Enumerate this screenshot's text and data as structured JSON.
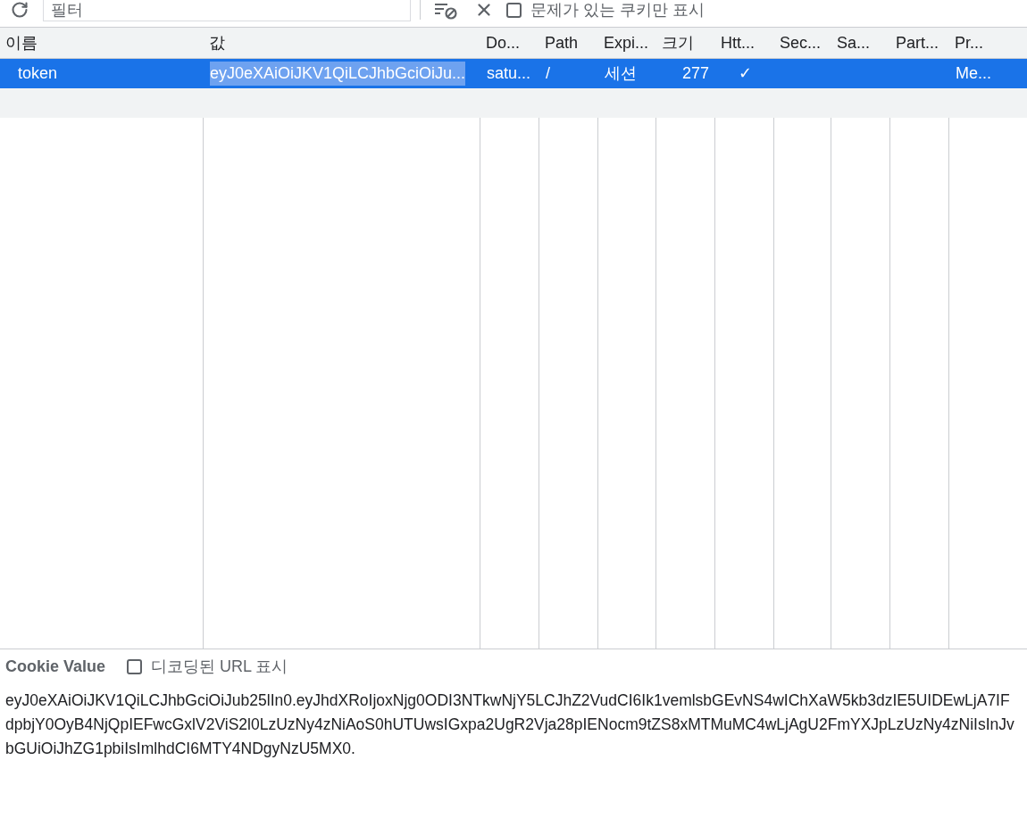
{
  "toolbar": {
    "filter_placeholder": "필터",
    "issues_only": {
      "label": "문제가 있는 쿠키만 표시",
      "checked": false
    }
  },
  "table": {
    "columns": [
      "이름",
      "값",
      "Do...",
      "Path",
      "Expi...",
      "크기",
      "Htt...",
      "Sec...",
      "Sa...",
      "Part...",
      "Pr..."
    ],
    "rows": [
      {
        "selected": true,
        "cells": [
          "token",
          "eyJ0eXAiOiJKV1QiLCJhbGciOiJu...",
          "satu...",
          "/",
          "세션",
          "277",
          "✓",
          "",
          "",
          "",
          "Me..."
        ]
      }
    ]
  },
  "details": {
    "title": "Cookie Value",
    "decoded": {
      "label": "디코딩된 URL 표시",
      "checked": false
    },
    "value": "eyJ0eXAiOiJKV1QiLCJhbGciOiJub25lIn0.eyJhdXRoIjoxNjg0ODI3NTkwNjY5LCJhZ2VudCI6Ik1vemlsbGEvNS4wIChXaW5kb3dzIE5UIDEwLjA7IFdpbjY0OyB4NjQpIEFwcGxlV2ViS2l0LzUzNy4zNiAoS0hUTUwsIGxpa2UgR2Vja28pIENocm9tZS8xMTMuMC4wLjAgU2FmYXJpLzUzNy4zNiIsInJvbGUiOiJhZG1pbiIsImlhdCI6MTY4NDgyNzU5MX0."
  }
}
